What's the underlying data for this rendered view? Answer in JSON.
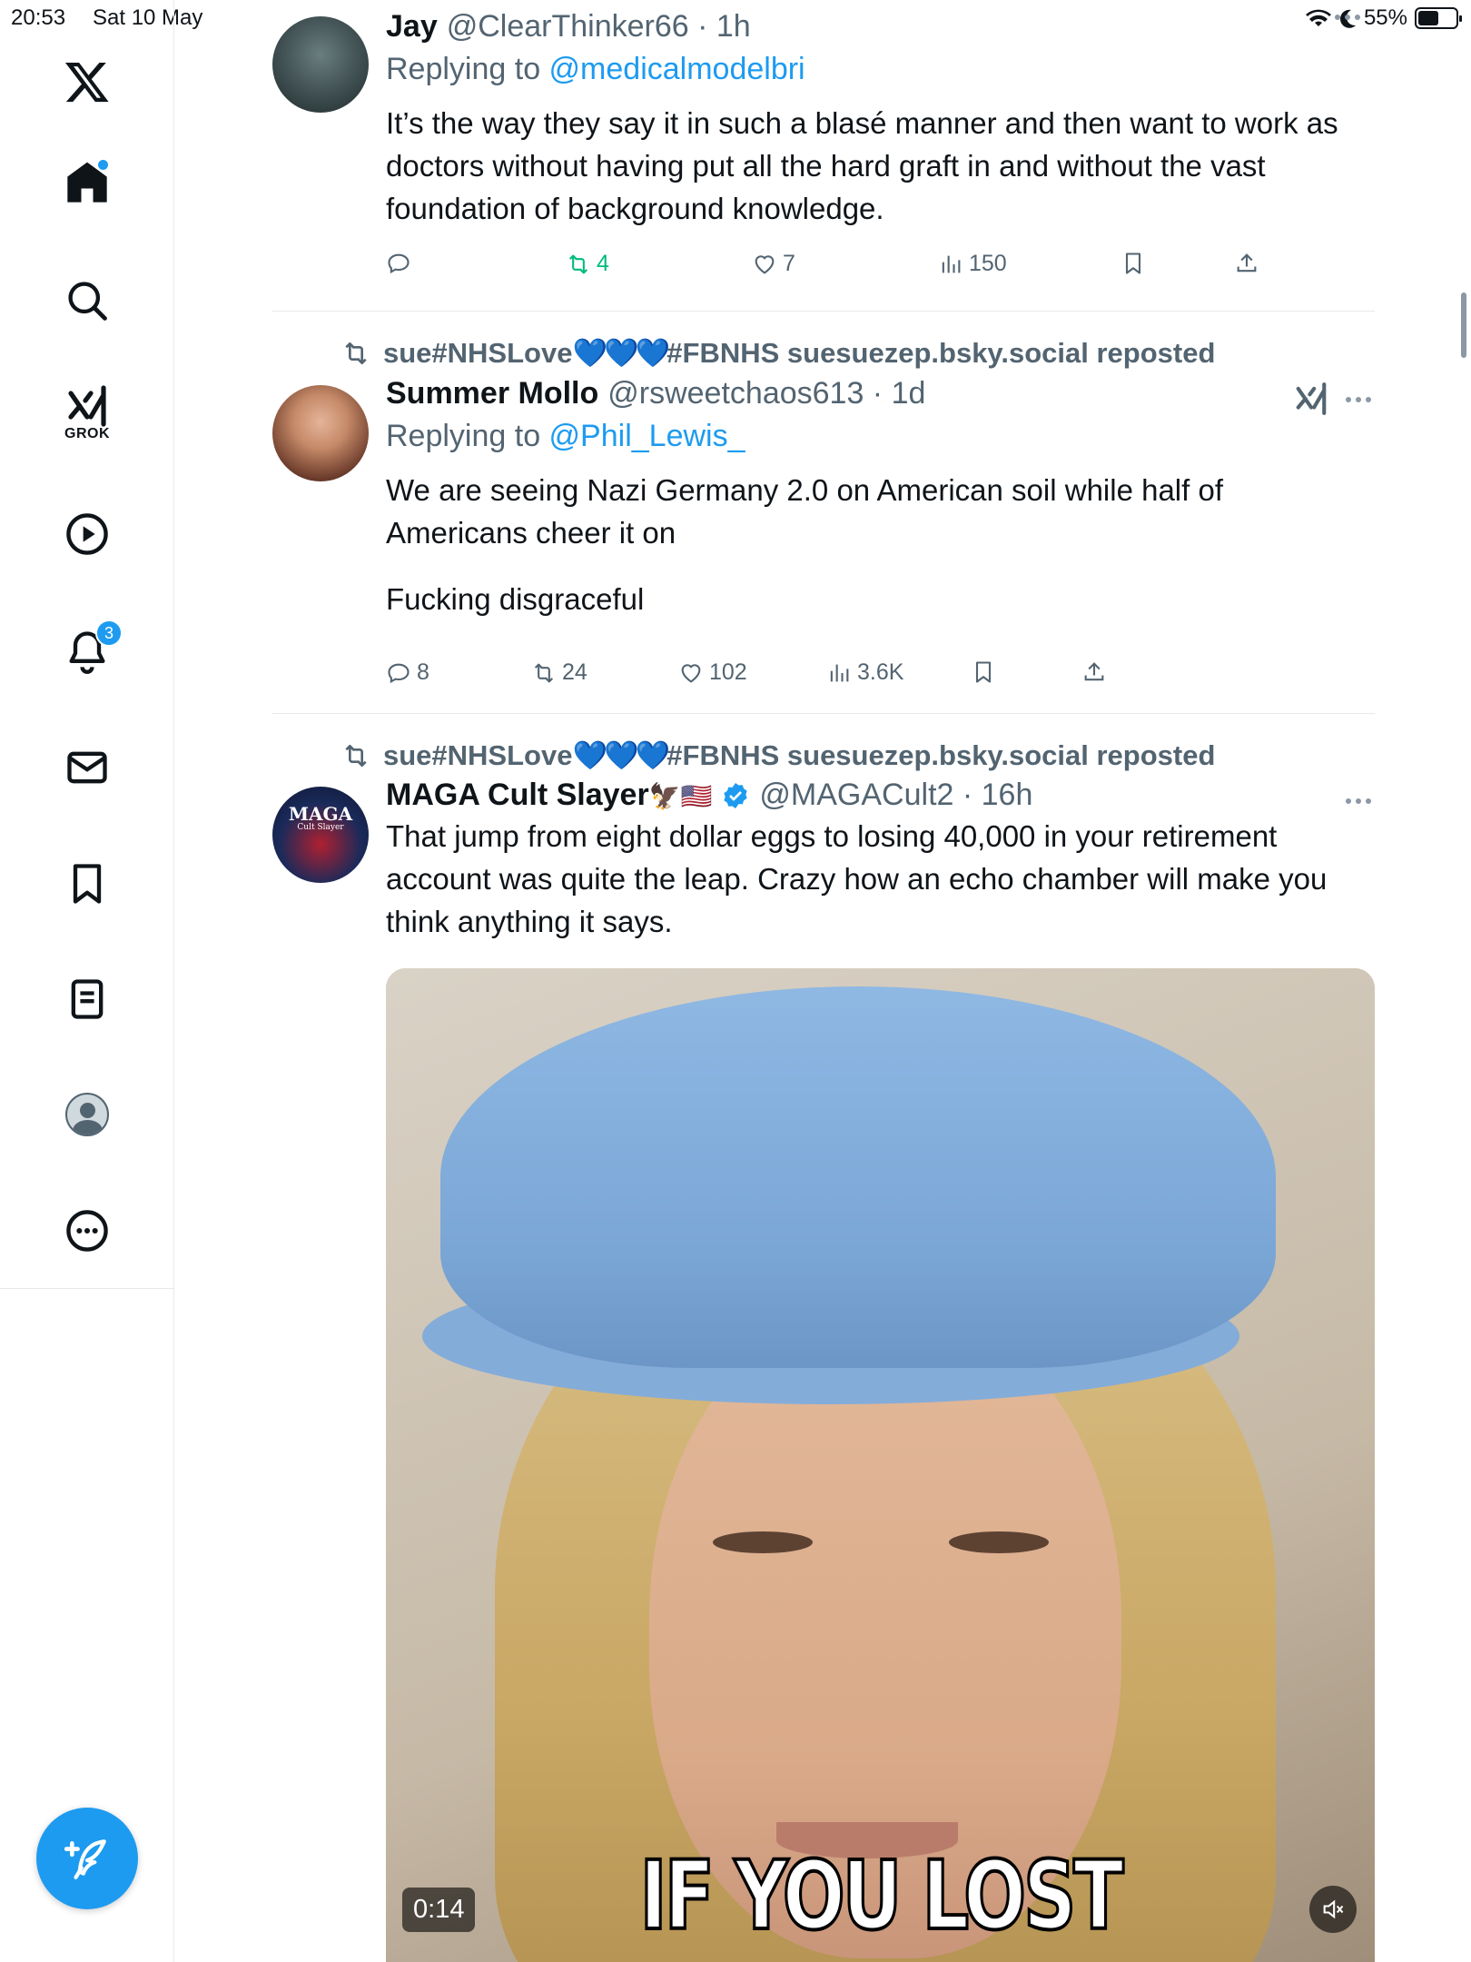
{
  "status_bar": {
    "time": "20:53",
    "date": "Sat 10 May",
    "battery": "55%",
    "battery_level": 0.55
  },
  "sidebar": {
    "items": [
      {
        "name": "x-logo",
        "label": ""
      },
      {
        "name": "home",
        "label": ""
      },
      {
        "name": "search",
        "label": ""
      },
      {
        "name": "grok",
        "label": "GROK"
      },
      {
        "name": "video",
        "label": ""
      },
      {
        "name": "notifications",
        "label": "",
        "badge": "3"
      },
      {
        "name": "messages",
        "label": ""
      },
      {
        "name": "bookmarks",
        "label": ""
      },
      {
        "name": "lists",
        "label": ""
      },
      {
        "name": "profile",
        "label": ""
      },
      {
        "name": "more",
        "label": ""
      }
    ]
  },
  "tweets": [
    {
      "name": "Jay",
      "handle": "@ClearThinker66 · 1h",
      "replying_prefix": "Replying to ",
      "replying_to": "@medicalmodelbri",
      "text": "It’s the way they say it in such a blasé manner and then want to work as doctors without having put all the hard graft in and without the vast foundation of background knowledge.",
      "replies": "",
      "reposts": "4",
      "likes": "7",
      "views": "150"
    },
    {
      "repost_by_prefix": "sue#NHSLove",
      "repost_by_hearts": "💙💙💙",
      "repost_by_suffix": "#FBNHS suesuezep.bsky.social reposted",
      "name": "Summer Mollo",
      "handle": "@rsweetchaos613 · 1d",
      "replying_prefix": "Replying to ",
      "replying_to": "@Phil_Lewis_",
      "text_line1": "We are seeing Nazi Germany 2.0 on American soil while half of Americans cheer it on",
      "text_line2": "Fucking disgraceful",
      "replies": "8",
      "reposts": "24",
      "likes": "102",
      "views": "3.6K"
    },
    {
      "repost_by_prefix": "sue#NHSLove",
      "repost_by_hearts": "💙💙💙",
      "repost_by_suffix": "#FBNHS suesuezep.bsky.social reposted",
      "name": "MAGA Cult Slayer",
      "name_emoji": "🦅🇺🇸",
      "handle": "@MAGACult2 · 16h",
      "avatar_text": "MAGA",
      "avatar_subtext": "Cult Slayer",
      "text": "That jump from eight dollar eggs to losing 40,000 in your retirement account was quite the leap. Crazy how an echo chamber will make you think anything it says.",
      "video": {
        "caption": "IF YOU LOST",
        "duration": "0:14"
      }
    }
  ],
  "colors": {
    "accent": "#1d9bf0",
    "repost_green": "#00ba7c",
    "secondary_text": "#536471"
  }
}
